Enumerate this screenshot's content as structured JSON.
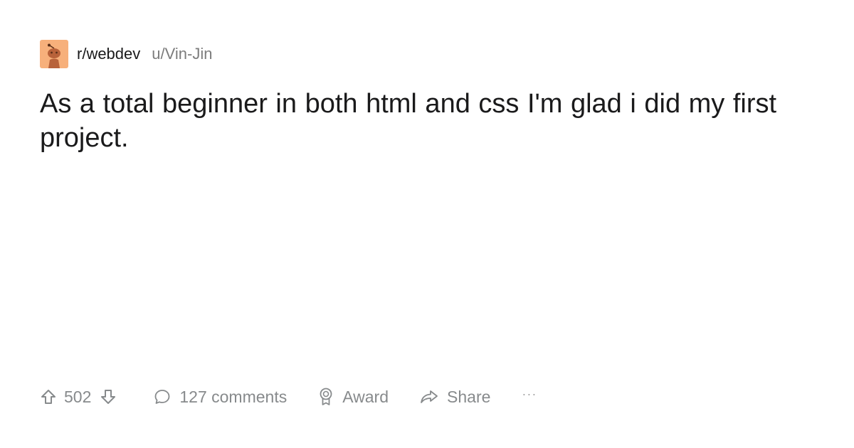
{
  "post": {
    "subreddit": "r/webdev",
    "author": "u/Vin-Jin",
    "title": "As a total beginner in both html and css I'm glad i did my first project."
  },
  "actions": {
    "upvote_count": "502",
    "comments_label": "127 comments",
    "award_label": "Award",
    "share_label": "Share",
    "more_label": "···"
  },
  "icons": {
    "community": "community-avatar-icon",
    "upvote": "arrow-up-icon",
    "downvote": "arrow-down-icon",
    "comment": "speech-bubble-icon",
    "award": "award-ribbon-icon",
    "share": "share-arrow-icon"
  },
  "colors": {
    "avatar_bg": "#f7b07b",
    "avatar_figure": "#b8623a",
    "text_primary": "#1a1a1b",
    "text_muted": "#878a8c"
  }
}
